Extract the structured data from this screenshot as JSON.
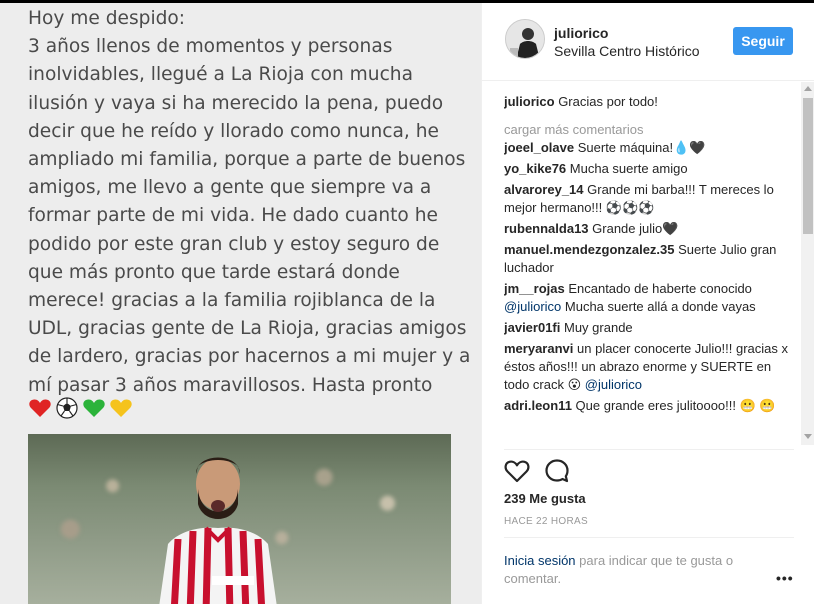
{
  "post_text_lines": [
    "Hoy me despido:",
    "3 años llenos de momentos y personas",
    "inolvidables, llegué a La Rioja con mucha",
    "ilusión y vaya si ha merecido la pena, puedo",
    "decir que he reído y llorado como nunca, he",
    "ampliado mi familia, porque a parte de buenos",
    "amigos, me llevo a gente que siempre va a",
    "formar parte de mi vida. He dado cuanto he",
    "podido por este gran club y estoy seguro de",
    "que más pronto que tarde estará donde",
    "merece! gracias a la familia rojiblanca de la",
    "UDL, gracias gente de La Rioja, gracias amigos",
    "de lardero, gracias por hacernos a mi mujer y a",
    "mí pasar 3 años maravillosos. Hasta pronto"
  ],
  "post_emojis": [
    "❤️",
    "⚽",
    "💚",
    "💛"
  ],
  "header": {
    "username": "juliorico",
    "location": "Sevilla Centro Histórico",
    "follow_label": "Seguir"
  },
  "caption": {
    "username": "juliorico",
    "text": "Gracias por todo!"
  },
  "load_more": "cargar más comentarios",
  "comments": [
    {
      "username": "joeel_olave",
      "text": "Suerte máquina!💧🖤"
    },
    {
      "username": "yo_kike76",
      "text": "Mucha suerte amigo"
    },
    {
      "username": "alvarorey_14",
      "text": "Grande mi barba!!! T mereces lo mejor hermano!!! ⚽⚽⚽"
    },
    {
      "username": "rubennalda13",
      "text": "Grande julio🖤"
    },
    {
      "username": "manuel.mendezgonzalez.35",
      "text": "Suerte Julio gran luchador"
    },
    {
      "username": "jm__rojas",
      "text": "Encantado de haberte conocido ",
      "mention": "@juliorico",
      "after": " Mucha suerte allá a donde vayas"
    },
    {
      "username": "javier01fi",
      "text": "Muy grande"
    },
    {
      "username": "meryaranvi",
      "text": "un placer conocerte Julio!!! gracias x éstos años!!! un abrazo enorme y SUERTE en todo crack 😮 ",
      "mention": "@juliorico",
      "after": ""
    },
    {
      "username": "adri.leon11",
      "text": "Que grande eres julitoooo!!! 😬 😬"
    }
  ],
  "likes": "239 Me gusta",
  "time_ago": "HACE 22 HORAS",
  "login": {
    "link": "Inicia sesión",
    "rest": " para indicar que te gusta o comentar."
  },
  "more_label": "•••",
  "colors": {
    "accent": "#3897f0",
    "link": "#003569",
    "muted": "#999999"
  }
}
